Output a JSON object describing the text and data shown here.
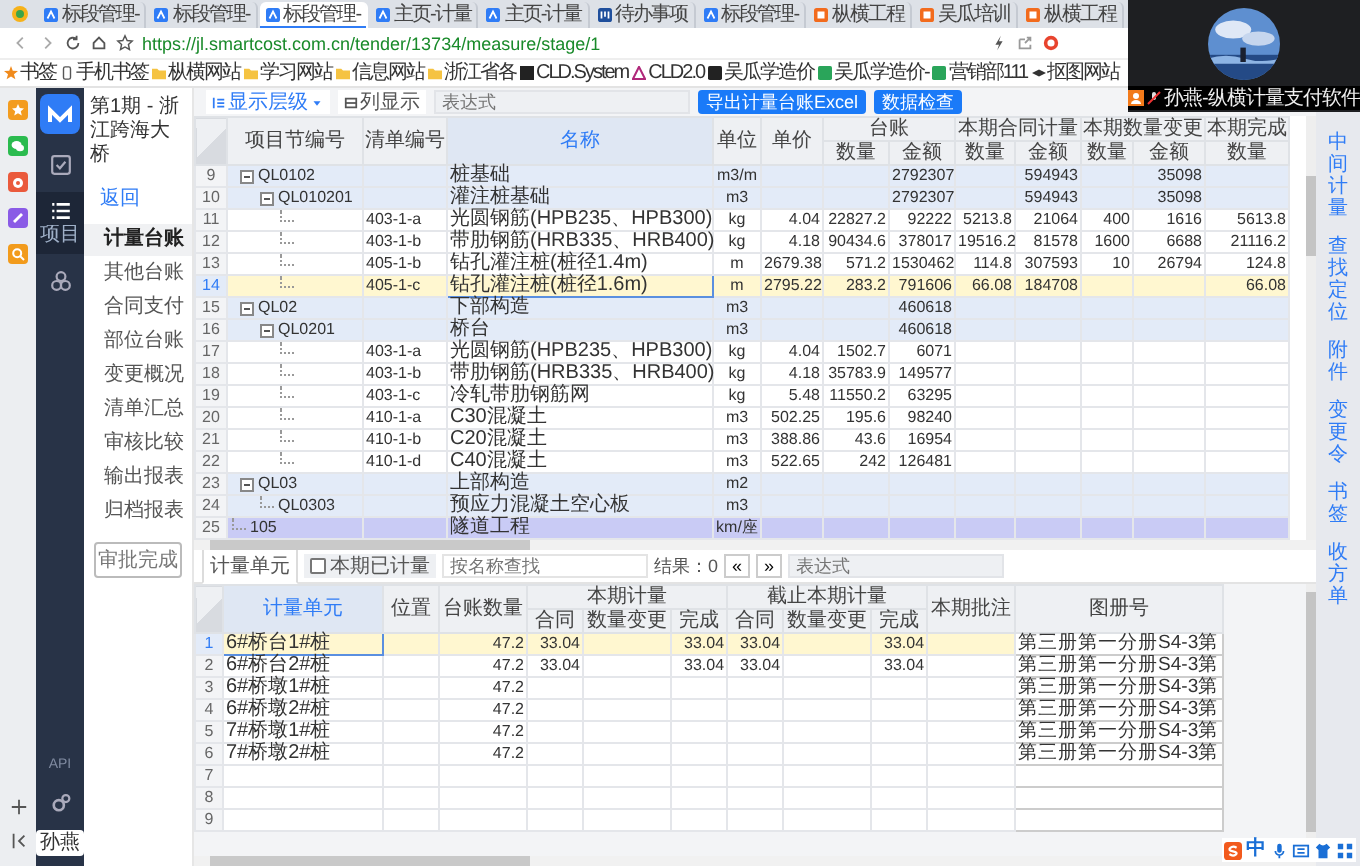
{
  "browser": {
    "tabs": [
      {
        "title": "标段管理-",
        "kind": "app",
        "selected": false
      },
      {
        "title": "标段管理-",
        "kind": "app",
        "selected": false
      },
      {
        "title": "标段管理-",
        "kind": "app",
        "selected": true
      },
      {
        "title": "主页-计量",
        "kind": "app",
        "selected": false
      },
      {
        "title": "主页-计量",
        "kind": "app",
        "selected": false
      },
      {
        "title": "待办事项",
        "kind": "board",
        "selected": false
      },
      {
        "title": "标段管理-",
        "kind": "app",
        "selected": false
      },
      {
        "title": "枞横工程",
        "kind": "site",
        "selected": false
      },
      {
        "title": "吴瓜培训",
        "kind": "site",
        "selected": false
      },
      {
        "title": "枞横工程",
        "kind": "site",
        "selected": false
      }
    ],
    "url": "https://jl.smartcost.com.cn/tender/13734/measure/stage/1",
    "bookmarks": [
      {
        "label": "书签",
        "kind": "star"
      },
      {
        "label": "手机书签",
        "kind": "phone"
      },
      {
        "label": "枞横网站",
        "kind": "folder"
      },
      {
        "label": "学习网站",
        "kind": "folder"
      },
      {
        "label": "信息网站",
        "kind": "folder"
      },
      {
        "label": "浙江省各",
        "kind": "folder"
      },
      {
        "label": "CLD.System",
        "kind": "cld"
      },
      {
        "label": "CLD2.0",
        "kind": "triangle"
      },
      {
        "label": "吴瓜学造价",
        "kind": "site"
      },
      {
        "label": "吴瓜学造价-",
        "kind": "sheet"
      },
      {
        "label": "营销部111",
        "kind": "sheet"
      },
      {
        "label": "抠图网站",
        "kind": "hat"
      }
    ],
    "video": {
      "caption": "孙燕-纵横计量支付软件"
    }
  },
  "app": {
    "sidebar": {
      "items": [
        {
          "kind": "check",
          "selected": false
        },
        {
          "kind": "list",
          "label": "项目",
          "selected": true
        },
        {
          "kind": "network",
          "selected": false
        }
      ],
      "api": "API",
      "user": "孙燕"
    },
    "nav": {
      "title": "第1期 - 浙江跨海大桥",
      "back": "返回",
      "items": [
        {
          "label": "计量台账",
          "selected": true
        },
        {
          "label": "其他台账",
          "selected": false
        },
        {
          "label": "合同支付",
          "selected": false
        },
        {
          "label": "部位台账",
          "selected": false
        },
        {
          "label": "变更概况",
          "selected": false
        },
        {
          "label": "清单汇总",
          "selected": false
        },
        {
          "label": "审核比较",
          "selected": false
        },
        {
          "label": "输出报表",
          "selected": false
        },
        {
          "label": "归档报表",
          "selected": false
        }
      ],
      "approve": "审批完成"
    },
    "toolbar": {
      "level": "显示层级",
      "columns": "列显示",
      "expression": {
        "placeholder": "表达式"
      },
      "buttons": [
        "导出计量台账Excel",
        "数据检查"
      ]
    },
    "ledger": {
      "columns": [
        {
          "label": "项目节编号",
          "selected": false
        },
        {
          "label": "清单编号",
          "selected": false
        },
        {
          "label": "名称",
          "selected": true
        },
        {
          "label": "单位",
          "selected": false
        },
        {
          "label": "单价",
          "selected": false
        }
      ],
      "groups": [
        {
          "label": "台账",
          "columns": [
            "数量",
            "金额"
          ]
        },
        {
          "label": "本期合同计量",
          "columns": [
            "数量",
            "金额"
          ]
        },
        {
          "label": "本期数量变更",
          "columns": [
            "数量",
            "金额"
          ]
        },
        {
          "label": "本期完成",
          "columns": [
            "数量"
          ]
        }
      ],
      "rows": [
        {
          "no": "9",
          "kind": "group",
          "code": "QL0102",
          "expanded": true,
          "selected": false,
          "name": "桩基础",
          "unit": "m3/m",
          "cells": [
            null,
            null,
            "2792307",
            null,
            "594943",
            null,
            "35098",
            null
          ],
          "children": [
            {
              "no": "10",
              "kind": "group",
              "code": "QL010201",
              "expanded": true,
              "selected": false,
              "name": "灌注桩基础",
              "unit": "m3",
              "cells": [
                null,
                null,
                "2792307",
                null,
                "594943",
                null,
                "35098",
                null
              ],
              "children": [
                {
                  "no": "11",
                  "kind": "leaf",
                  "bill": "403-1-a",
                  "selected": false,
                  "name": "光圆钢筋(HPB235、HPB300)",
                  "unit": "kg",
                  "cells": [
                    "4.04",
                    "22827.2",
                    "92222",
                    "5213.8",
                    "21064",
                    "400",
                    "1616",
                    "5613.8"
                  ]
                },
                {
                  "no": "12",
                  "kind": "leaf",
                  "bill": "403-1-b",
                  "selected": false,
                  "name": "带肋钢筋(HRB335、HRB400)",
                  "unit": "kg",
                  "cells": [
                    "4.18",
                    "90434.6",
                    "378017",
                    "19516.2",
                    "81578",
                    "1600",
                    "6688",
                    "21116.2"
                  ]
                },
                {
                  "no": "13",
                  "kind": "leaf",
                  "bill": "405-1-b",
                  "selected": false,
                  "name": "钻孔灌注桩(桩径1.4m)",
                  "unit": "m",
                  "cells": [
                    "2679.38",
                    "571.2",
                    "1530462",
                    "114.8",
                    "307593",
                    "10",
                    "26794",
                    "124.8"
                  ]
                },
                {
                  "no": "14",
                  "kind": "leaf",
                  "bill": "405-1-c",
                  "selected": true,
                  "name": "钻孔灌注桩(桩径1.6m)",
                  "unit": "m",
                  "cells": [
                    "2795.22",
                    "283.2",
                    "791606",
                    "66.08",
                    "184708",
                    null,
                    null,
                    "66.08"
                  ]
                }
              ]
            }
          ]
        },
        {
          "no": "15",
          "kind": "group",
          "code": "QL02",
          "expanded": true,
          "selected": false,
          "name": "下部构造",
          "unit": "m3",
          "cells": [
            null,
            null,
            "460618",
            null,
            null,
            null,
            null,
            null
          ],
          "children": [
            {
              "no": "16",
              "kind": "group",
              "code": "QL0201",
              "expanded": true,
              "selected": false,
              "name": "桥台",
              "unit": "m3",
              "cells": [
                null,
                null,
                "460618",
                null,
                null,
                null,
                null,
                null
              ],
              "children": [
                {
                  "no": "17",
                  "kind": "leaf",
                  "bill": "403-1-a",
                  "selected": false,
                  "name": "光圆钢筋(HPB235、HPB300)",
                  "unit": "kg",
                  "cells": [
                    "4.04",
                    "1502.7",
                    "6071",
                    null,
                    null,
                    null,
                    null,
                    null
                  ]
                },
                {
                  "no": "18",
                  "kind": "leaf",
                  "bill": "403-1-b",
                  "selected": false,
                  "name": "带肋钢筋(HRB335、HRB400)",
                  "unit": "kg",
                  "cells": [
                    "4.18",
                    "35783.9",
                    "149577",
                    null,
                    null,
                    null,
                    null,
                    null
                  ]
                },
                {
                  "no": "19",
                  "kind": "leaf",
                  "bill": "403-1-c",
                  "selected": false,
                  "name": "冷轧带肋钢筋网",
                  "unit": "kg",
                  "cells": [
                    "5.48",
                    "11550.2",
                    "63295",
                    null,
                    null,
                    null,
                    null,
                    null
                  ]
                },
                {
                  "no": "20",
                  "kind": "leaf",
                  "bill": "410-1-a",
                  "selected": false,
                  "name": "C30混凝土",
                  "unit": "m3",
                  "cells": [
                    "502.25",
                    "195.6",
                    "98240",
                    null,
                    null,
                    null,
                    null,
                    null
                  ]
                },
                {
                  "no": "21",
                  "kind": "leaf",
                  "bill": "410-1-b",
                  "selected": false,
                  "name": "C20混凝土",
                  "unit": "m3",
                  "cells": [
                    "388.86",
                    "43.6",
                    "16954",
                    null,
                    null,
                    null,
                    null,
                    null
                  ]
                },
                {
                  "no": "22",
                  "kind": "leaf",
                  "bill": "410-1-d",
                  "selected": false,
                  "name": "C40混凝土",
                  "unit": "m3",
                  "cells": [
                    "522.65",
                    "242",
                    "126481",
                    null,
                    null,
                    null,
                    null,
                    null
                  ]
                }
              ]
            }
          ]
        },
        {
          "no": "23",
          "kind": "group",
          "code": "QL03",
          "expanded": true,
          "selected": false,
          "name": "上部构造",
          "unit": "m2",
          "cells": [
            null,
            null,
            null,
            null,
            null,
            null,
            null,
            null
          ],
          "children": [
            {
              "no": "24",
              "kind": "group",
              "code": "QL0303",
              "selected": false,
              "name": "预应力混凝土空心板",
              "unit": "m3",
              "cells": [
                null,
                null,
                null,
                null,
                null,
                null,
                null,
                null
              ]
            }
          ]
        },
        {
          "no": "25",
          "kind": "unit",
          "code": "105",
          "selected": false,
          "name": "隧道工程",
          "unit": "km/座",
          "cells": [
            null,
            null,
            null,
            null,
            null,
            null,
            null,
            null
          ]
        }
      ]
    },
    "units_bar": {
      "tab": {
        "label": "计量单元",
        "selected": true
      },
      "filter": {
        "label": "本期已计量",
        "checked": false
      },
      "search": {
        "placeholder": "按名称查找"
      },
      "result": "结果：0",
      "pager": [
        "«",
        "»"
      ],
      "expression": {
        "placeholder": "表达式"
      }
    },
    "units": {
      "columns": [
        {
          "label": "计量单元",
          "selected": true
        },
        {
          "label": "位置",
          "selected": false
        },
        {
          "label": "台账数量",
          "selected": false
        }
      ],
      "groups": [
        {
          "label": "本期计量",
          "columns": [
            "合同",
            "数量变更",
            "完成"
          ]
        },
        {
          "label": "截止本期计量",
          "columns": [
            "合同",
            "数量变更",
            "完成"
          ]
        }
      ],
      "tail_columns": [
        "本期批注",
        "图册号"
      ],
      "rows": [
        {
          "no": "1",
          "selected": true,
          "name": "6#桥台1#桩",
          "cells": [
            null,
            "47.2",
            "33.04",
            null,
            "33.04",
            "33.04",
            null,
            "33.04",
            null
          ],
          "drawing": "第三册第一分册S4-3第"
        },
        {
          "no": "2",
          "selected": false,
          "name": "6#桥台2#桩",
          "cells": [
            null,
            "47.2",
            "33.04",
            null,
            "33.04",
            "33.04",
            null,
            "33.04",
            null
          ],
          "drawing": "第三册第一分册S4-3第"
        },
        {
          "no": "3",
          "selected": false,
          "name": "6#桥墩1#桩",
          "cells": [
            null,
            "47.2",
            null,
            null,
            null,
            null,
            null,
            null,
            null
          ],
          "drawing": "第三册第一分册S4-3第"
        },
        {
          "no": "4",
          "selected": false,
          "name": "6#桥墩2#桩",
          "cells": [
            null,
            "47.2",
            null,
            null,
            null,
            null,
            null,
            null,
            null
          ],
          "drawing": "第三册第一分册S4-3第"
        },
        {
          "no": "5",
          "selected": false,
          "name": "7#桥墩1#桩",
          "cells": [
            null,
            "47.2",
            null,
            null,
            null,
            null,
            null,
            null,
            null
          ],
          "drawing": "第三册第一分册S4-3第"
        },
        {
          "no": "6",
          "selected": false,
          "name": "7#桥墩2#桩",
          "cells": [
            null,
            "47.2",
            null,
            null,
            null,
            null,
            null,
            null,
            null
          ],
          "drawing": "第三册第一分册S4-3第"
        },
        {
          "no": "7",
          "selected": false
        },
        {
          "no": "8",
          "selected": false
        },
        {
          "no": "9",
          "selected": false
        }
      ]
    },
    "side_links": [
      "中间计量",
      "查找定位",
      "附件",
      "变更令",
      "书签",
      "收方单"
    ],
    "ime": {
      "mode": "中"
    }
  }
}
